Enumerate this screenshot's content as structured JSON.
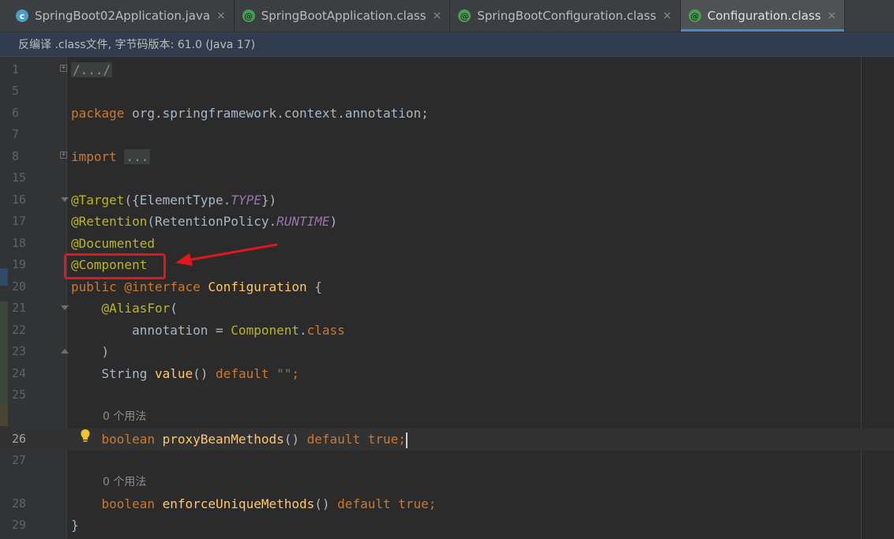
{
  "tabs": [
    {
      "label": "SpringBoot02Application.java",
      "icon": "java-class-icon",
      "active": false
    },
    {
      "label": "SpringBootApplication.class",
      "icon": "annotation-icon",
      "active": false
    },
    {
      "label": "SpringBootConfiguration.class",
      "icon": "annotation-icon",
      "active": false
    },
    {
      "label": "Configuration.class",
      "icon": "annotation-icon",
      "active": true
    }
  ],
  "tab_close_glyph": "×",
  "banner": "反编译 .class文件, 字节码版本: 61.0 (Java 17)",
  "gutter": {
    "line_numbers": [
      "1",
      "5",
      "6",
      "7",
      "8",
      "15",
      "16",
      "17",
      "18",
      "19",
      "20",
      "21",
      "22",
      "23",
      "24",
      "25",
      "26",
      "27",
      "28",
      "29"
    ],
    "current_line": "26"
  },
  "code": {
    "l1": "/.../",
    "l6_kw": "package",
    "l6_rest": " org.springframework.context.annotation;",
    "l8_kw": "import",
    "l8_folded": "...",
    "l16_ann": "@Target",
    "l16_a": "({ElementType.",
    "l16_fld": "TYPE",
    "l16_b": "})",
    "l17_ann": "@Retention",
    "l17_a": "(RetentionPolicy.",
    "l17_fld": "RUNTIME",
    "l17_b": ")",
    "l18_ann": "@Documented",
    "l19_ann": "@Component",
    "l20_kw1": "public",
    "l20_at": " @",
    "l20_kw2": "interface",
    "l20_name": " Configuration",
    "l20_brace": " {",
    "l21_ann": "    @AliasFor",
    "l21_paren": "(",
    "l22_a": "        annotation = ",
    "l22_type": "Component",
    "l22_dot": ".",
    "l22_kw": "class",
    "l23": "    )",
    "l24_type": "    String ",
    "l24_fn": "value",
    "l24_paren": "() ",
    "l24_kw": "default",
    "l24_sp": " ",
    "l24_str": "\"\"",
    "l24_semi": ";",
    "hint1": "0 个用法",
    "l26_kw": "    boolean",
    "l26_fn": " proxyBeanMethods",
    "l26_paren": "() ",
    "l26_kw2": "default",
    "l26_sp": " ",
    "l26_kw3": "true",
    "l26_semi": ";",
    "hint2": "0 个用法",
    "l28_kw": "    boolean",
    "l28_fn": " enforceUniqueMethods",
    "l28_paren": "() ",
    "l28_kw2": "default",
    "l28_sp": " ",
    "l28_kw3": "true",
    "l28_semi": ";",
    "l29": "}"
  },
  "colors": {
    "highlight_box": "#e3161e",
    "arrow": "#e3161e",
    "keyword": "#cc7832",
    "annotation": "#bbb529",
    "field": "#9876aa",
    "string": "#6a8759",
    "accent": "#4a88c7"
  }
}
